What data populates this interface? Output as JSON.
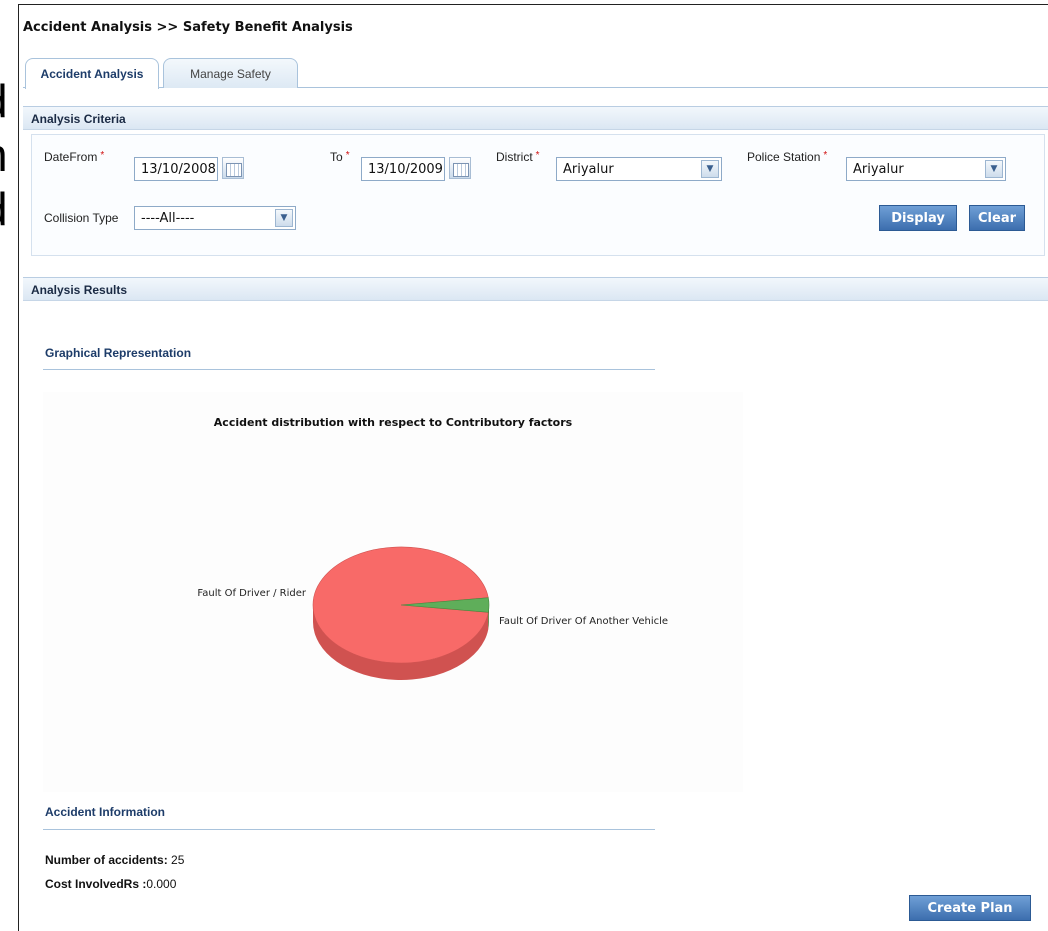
{
  "breadcrumb": "Accident Analysis >> Safety Benefit Analysis",
  "tabs": [
    {
      "label": "Accident Analysis",
      "active": true
    },
    {
      "label": "Manage Safety",
      "active": false
    }
  ],
  "criteria": {
    "title": "Analysis Criteria",
    "date_from_label": "DateFrom",
    "date_from_value": "13/10/2008",
    "to_label": "To",
    "to_value": "13/10/2009",
    "district_label": "District",
    "district_value": "Ariyalur",
    "police_station_label": "Police Station",
    "police_station_value": "Ariyalur",
    "collision_type_label": "Collision Type",
    "collision_type_value": "----All----",
    "required_mark": "*",
    "display_label": "Display",
    "clear_label": "Clear"
  },
  "results": {
    "title": "Analysis Results",
    "graph_title": "Graphical Representation",
    "info_title": "Accident Information",
    "accidents_label": "Number of accidents:",
    "accidents_value": "25",
    "cost_label": "Cost InvolvedRs :",
    "cost_value": "0.000",
    "create_plan_label": "Create Plan"
  },
  "chart_data": {
    "type": "pie",
    "title": "Accident distribution with respect to Contributory factors",
    "labels": [
      "Fault Of Driver / Rider",
      "Fault Of Driver Of Another Vehicle"
    ],
    "values": [
      24,
      1
    ],
    "colors": [
      "#f86a68",
      "#5fae5a"
    ],
    "shade_colors": [
      "#d05250",
      "#3f8a3c"
    ]
  },
  "colors": {
    "accent": "#3c6eae",
    "header_text": "#1d3c69",
    "required": "#d01010"
  },
  "background_fragments": [
    "d",
    "n",
    "d"
  ]
}
